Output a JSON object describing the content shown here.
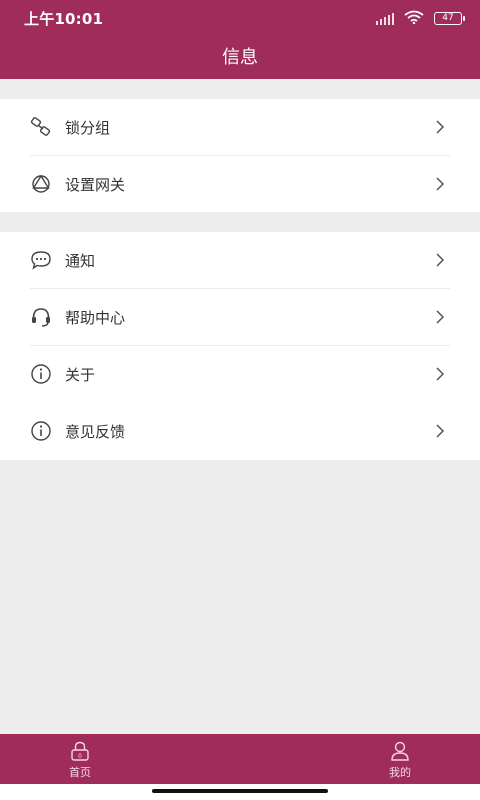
{
  "status_bar": {
    "time": "上午10:01",
    "battery_level": "47"
  },
  "header": {
    "title": "信息"
  },
  "menu_groups": [
    {
      "items": [
        {
          "label": "锁分组",
          "icon": "link-icon"
        },
        {
          "label": "设置网关",
          "icon": "network-triangle-icon"
        }
      ]
    },
    {
      "items": [
        {
          "label": "通知",
          "icon": "chat-bubble-icon"
        },
        {
          "label": "帮助中心",
          "icon": "headset-icon"
        },
        {
          "label": "关于",
          "icon": "info-icon"
        },
        {
          "label": "意见反馈",
          "icon": "info-icon"
        }
      ]
    }
  ],
  "tab_bar": {
    "tabs": [
      {
        "label": "首页",
        "icon": "lock-icon"
      },
      {
        "label": "我的",
        "icon": "user-icon"
      }
    ]
  },
  "colors": {
    "brand": "#a02c5a",
    "background": "#ededed",
    "surface": "#ffffff",
    "text": "#333333"
  }
}
